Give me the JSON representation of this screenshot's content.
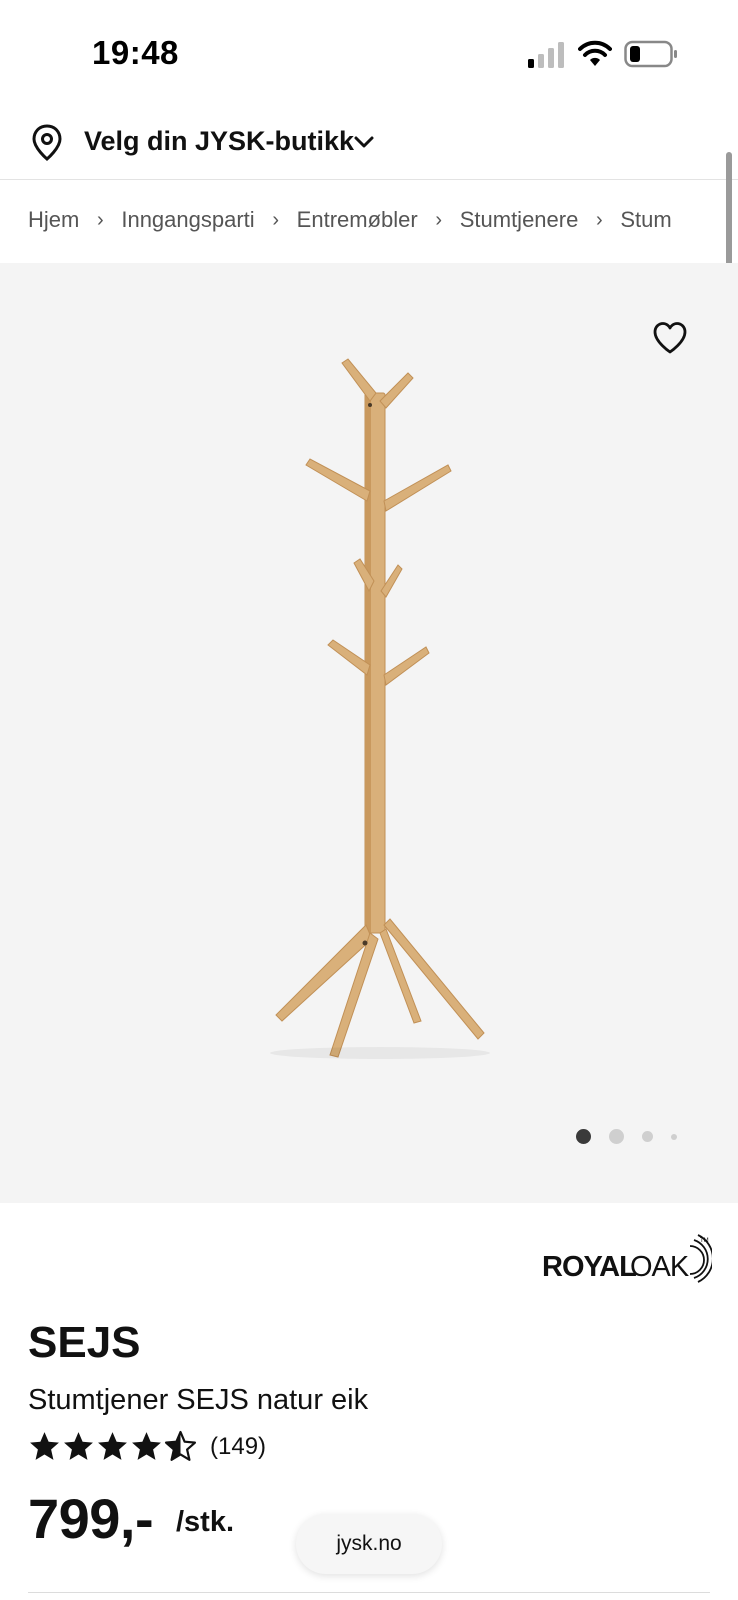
{
  "status_bar": {
    "time": "19:48"
  },
  "store_selector": {
    "label": "Velg din JYSK-butikk"
  },
  "breadcrumb": [
    "Hjem",
    "Inngangsparti",
    "Entremøbler",
    "Stumtjenere",
    "Stum"
  ],
  "gallery": {
    "image_count": 4,
    "active_index": 0
  },
  "brand": {
    "logo_text": "ROYALOAK"
  },
  "product": {
    "name": "SEJS",
    "description": "Stumtjener SEJS natur eik",
    "rating": 4.5,
    "review_count": "(149)",
    "price": "799,-",
    "unit": "/stk."
  },
  "url_pill": "jysk.no",
  "colors": {
    "wood": "#d9b07a",
    "wood_dark": "#c9995e",
    "gallery_bg": "#f4f4f4"
  }
}
